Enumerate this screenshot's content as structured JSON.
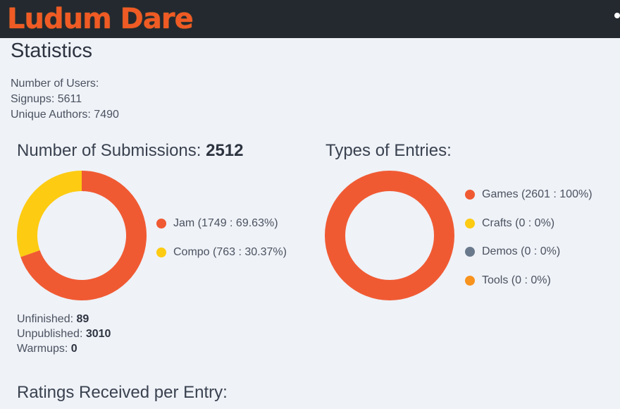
{
  "header": {
    "logo_text": "Ludum Dare"
  },
  "page": {
    "title": "Statistics"
  },
  "users": {
    "heading": "Number of Users:",
    "signups_label": "Signups: ",
    "signups_value": "5611",
    "authors_label": "Unique Authors: ",
    "authors_value": "7490"
  },
  "submissions": {
    "title": "Number of Submissions: ",
    "total": "2512",
    "legend": [
      {
        "label": "Jam (1749 : 69.63%)",
        "color": "#f05a33"
      },
      {
        "label": "Compo (763 : 30.37%)",
        "color": "#fdcb12"
      }
    ],
    "unfinished_label": "Unfinished: ",
    "unfinished_value": "89",
    "unpublished_label": "Unpublished: ",
    "unpublished_value": "3010",
    "warmups_label": "Warmups: ",
    "warmups_value": "0"
  },
  "entry_types": {
    "title": "Types of Entries:",
    "legend": [
      {
        "label": "Games (2601 : 100%)",
        "color": "#f05a33"
      },
      {
        "label": "Crafts (0 : 0%)",
        "color": "#fdcb12"
      },
      {
        "label": "Demos (0 : 0%)",
        "color": "#6a7a8c"
      },
      {
        "label": "Tools (0 : 0%)",
        "color": "#f7931e"
      }
    ]
  },
  "ratings": {
    "title": "Ratings Received per Entry:"
  },
  "chart_data": [
    {
      "type": "pie",
      "title": "Number of Submissions: 2512",
      "categories": [
        "Jam",
        "Compo"
      ],
      "values": [
        1749,
        763
      ],
      "colors": [
        "#f05a33",
        "#fdcb12"
      ]
    },
    {
      "type": "pie",
      "title": "Types of Entries:",
      "categories": [
        "Games",
        "Crafts",
        "Demos",
        "Tools"
      ],
      "values": [
        2601,
        0,
        0,
        0
      ],
      "colors": [
        "#f05a33",
        "#fdcb12",
        "#6a7a8c",
        "#f7931e"
      ]
    }
  ]
}
